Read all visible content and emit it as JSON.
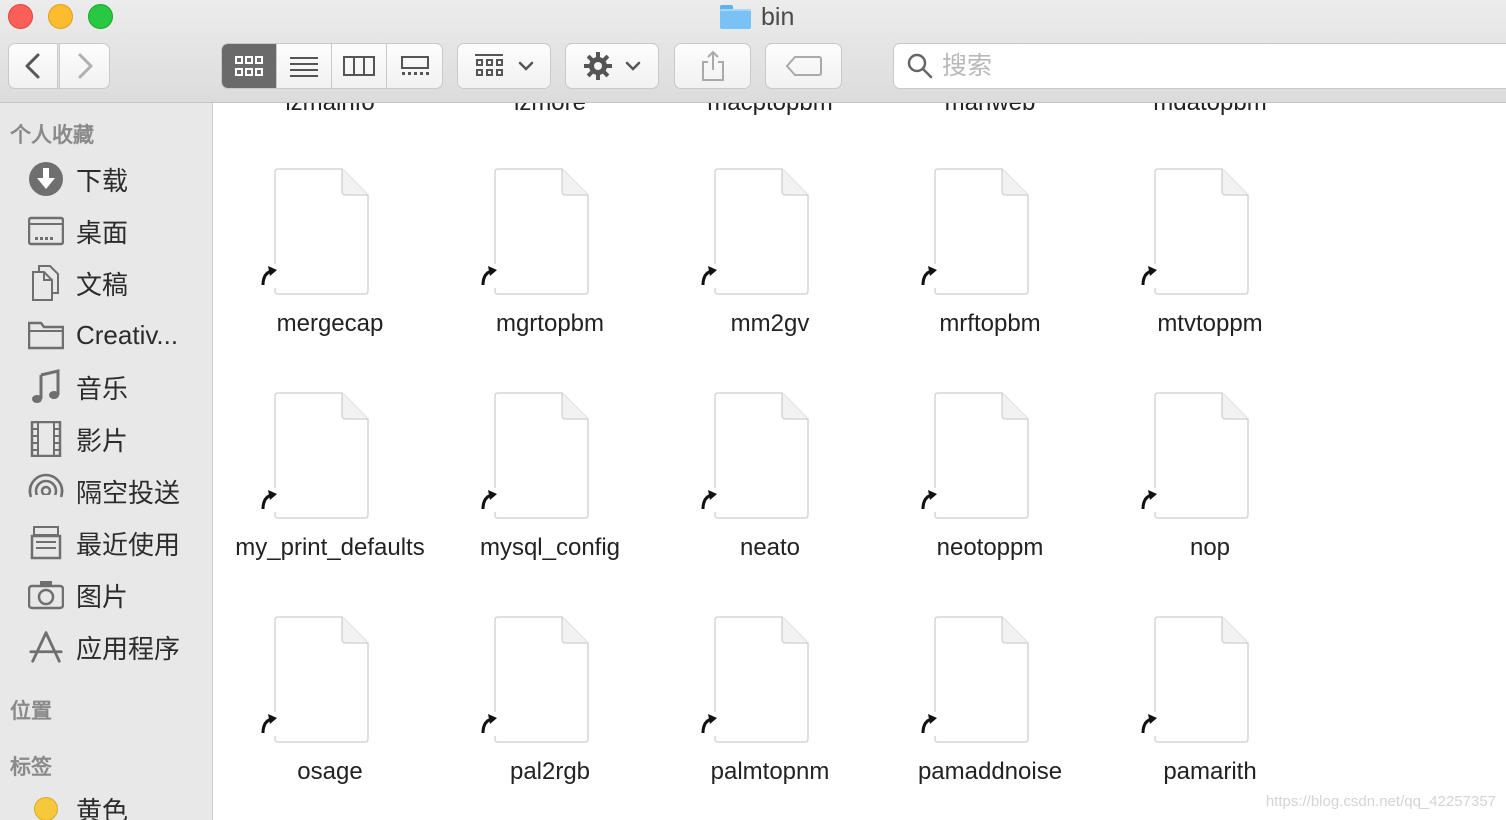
{
  "window": {
    "title": "bin"
  },
  "toolbar": {
    "search_placeholder": "搜索",
    "icons": {
      "back": "chevron-left-icon",
      "forward": "chevron-right-icon",
      "view_icons": "icon-view-icon",
      "view_list": "list-view-icon",
      "view_columns": "column-view-icon",
      "view_gallery": "gallery-view-icon",
      "group": "group-icon",
      "action": "gear-icon",
      "share": "share-icon",
      "tag": "tag-icon",
      "search": "search-icon"
    }
  },
  "sidebar": {
    "favorites_heading": "个人收藏",
    "items": [
      {
        "label": "下载",
        "icon": "downloads-icon"
      },
      {
        "label": "桌面",
        "icon": "desktop-icon"
      },
      {
        "label": "文稿",
        "icon": "documents-icon"
      },
      {
        "label": "Creativ...",
        "icon": "folder-icon"
      },
      {
        "label": "音乐",
        "icon": "music-icon"
      },
      {
        "label": "影片",
        "icon": "movies-icon"
      },
      {
        "label": "隔空投送",
        "icon": "airdrop-icon"
      },
      {
        "label": "最近使用",
        "icon": "recents-icon"
      },
      {
        "label": "图片",
        "icon": "pictures-icon"
      },
      {
        "label": "应用程序",
        "icon": "applications-icon"
      }
    ],
    "locations_heading": "位置",
    "tags_heading": "标签",
    "tags": [
      {
        "label": "黄色",
        "color": "#f6c93d"
      }
    ]
  },
  "files": {
    "cutoff_row": [
      "lzmainfo",
      "lzmore",
      "macptopbm",
      "manweb",
      "mdatopbm"
    ],
    "rows": [
      [
        "mergecap",
        "mgrtopbm",
        "mm2gv",
        "mrftopbm",
        "mtvtoppm"
      ],
      [
        "my_print_defaults",
        "mysql_config",
        "neato",
        "neotoppm",
        "nop"
      ],
      [
        "osage",
        "pal2rgb",
        "palmtopnm",
        "pamaddnoise",
        "pamarith"
      ]
    ]
  },
  "watermark": "https://blog.csdn.net/qq_42257357"
}
